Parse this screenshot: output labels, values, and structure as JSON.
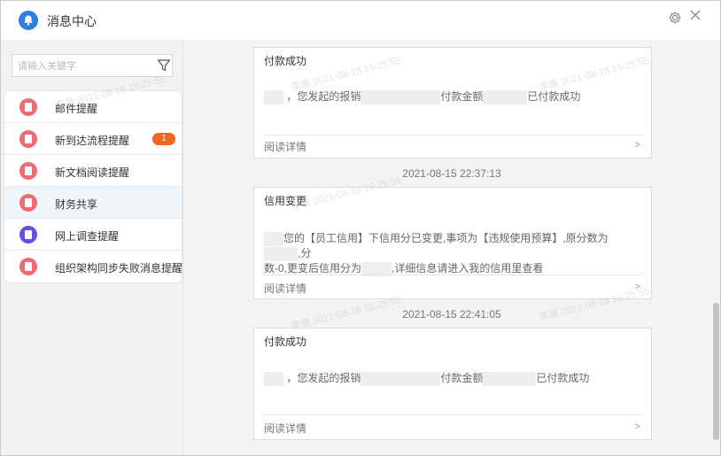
{
  "window": {
    "title": "消息中心"
  },
  "search": {
    "placeholder": "请输入关键字"
  },
  "sidebar": {
    "items": [
      {
        "label": "邮件提醒",
        "icon": "document-icon",
        "color": "#f06b74"
      },
      {
        "label": "新到达流程提醒",
        "icon": "document-icon",
        "color": "#f06b74",
        "badge": "1"
      },
      {
        "label": "新文档阅读提醒",
        "icon": "document-icon",
        "color": "#f06b74"
      },
      {
        "label": "财务共享",
        "icon": "document-icon",
        "color": "#f06b74",
        "active": true
      },
      {
        "label": "网上调查提醒",
        "icon": "survey-icon",
        "color": "#6b4de6"
      },
      {
        "label": "组织架构同步失败消息提醒",
        "icon": "document-icon",
        "color": "#f06b74"
      }
    ]
  },
  "messages": [
    {
      "title": "付款成功",
      "body_parts": [
        "，您发起的报销",
        "付款金额",
        "已付款成功"
      ],
      "read_label": "阅读详情",
      "chevron": ">"
    },
    {
      "timestamp": "2021-08-15 22:37:13",
      "title": "信用变更",
      "body_parts": [
        "您的【员工信用】下信用分已变更,事项为【违规使用预算】,原分数为",
        ",分",
        "数-0,更变后信用分为",
        ",详细信息请进入我的信用里查看"
      ],
      "read_label": "阅读详情",
      "chevron": ">"
    },
    {
      "timestamp": "2021-08-15 22:41:05",
      "title": "付款成功",
      "body_parts": [
        "，您发起的报销",
        "付款金额",
        "已付款成功"
      ],
      "read_label": "阅读详情",
      "chevron": ">"
    }
  ],
  "watermark": "李展 2021-08-18 15:25:55",
  "colors": {
    "accent": "#2f7ddf",
    "badge": "#f26522",
    "active_bg": "#eef5fb"
  }
}
